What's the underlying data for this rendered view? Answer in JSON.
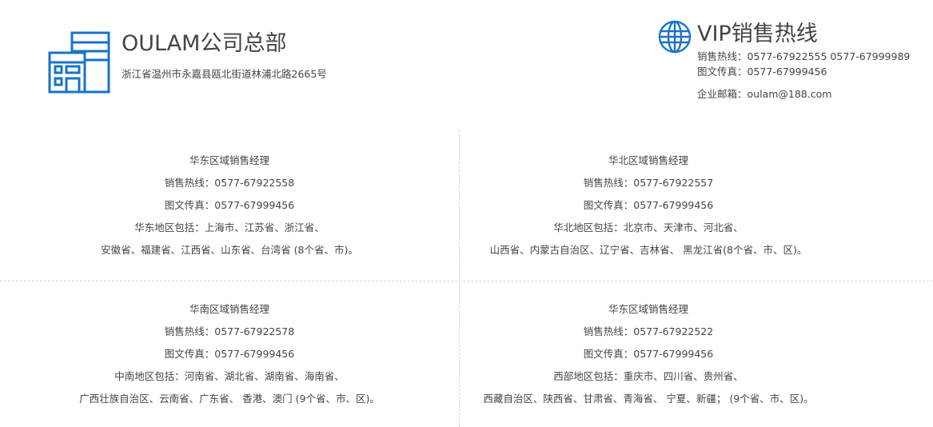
{
  "hq": {
    "title": "OULAM公司总部",
    "address": "浙江省温州市永嘉县瓯北街道林浦北路2665号"
  },
  "vip": {
    "title": "VIP销售热线",
    "hotline": "销售热线：0577-67922555 0577-67999989",
    "fax": "图文传真：0577-67999456",
    "email": "企业邮箱：oulam@188.com"
  },
  "colors": {
    "accent": "#1a73c8"
  },
  "icons": {
    "hq": "building-icon",
    "vip": "globe-icon"
  },
  "regions": [
    {
      "title": "华东区域销售经理",
      "hotline": "销售热线：0577-67922558",
      "fax": "图文传真：0577-67999456",
      "coverage1": "华东地区包括：上海市、江苏省、浙江省、",
      "coverage2": "安徽省、福建省、江西省、山东省、台湾省 (8个省、市)。"
    },
    {
      "title": "华北区域销售经理",
      "hotline": "销售热线：0577-67922557",
      "fax": "图文传真：0577-67999456",
      "coverage1": "华北地区包括：北京市、天津市、河北省、",
      "coverage2": "山西省、内蒙古自治区、辽宁省、吉林省、 黑龙江省(8个省、市、区)。"
    },
    {
      "title": "华南区域销售经理",
      "hotline": "销售热线：0577-67922578",
      "fax": "图文传真：0577-67999456",
      "coverage1": "中南地区包括：河南省、湖北省、湖南省、海南省、",
      "coverage2": "广西壮族自治区、云南省、广东省、 香港、澳门 (9个省、市、区)。"
    },
    {
      "title": "华东区域销售经理",
      "hotline": "销售热线：0577-67922522",
      "fax": "图文传真：0577-67999456",
      "coverage1": "西部地区包括：重庆市、四川省、贵州省、",
      "coverage2": "西藏自治区、陕西省、甘肃省、青海省、 宁夏、新疆； (9个省、市、区)。"
    }
  ]
}
